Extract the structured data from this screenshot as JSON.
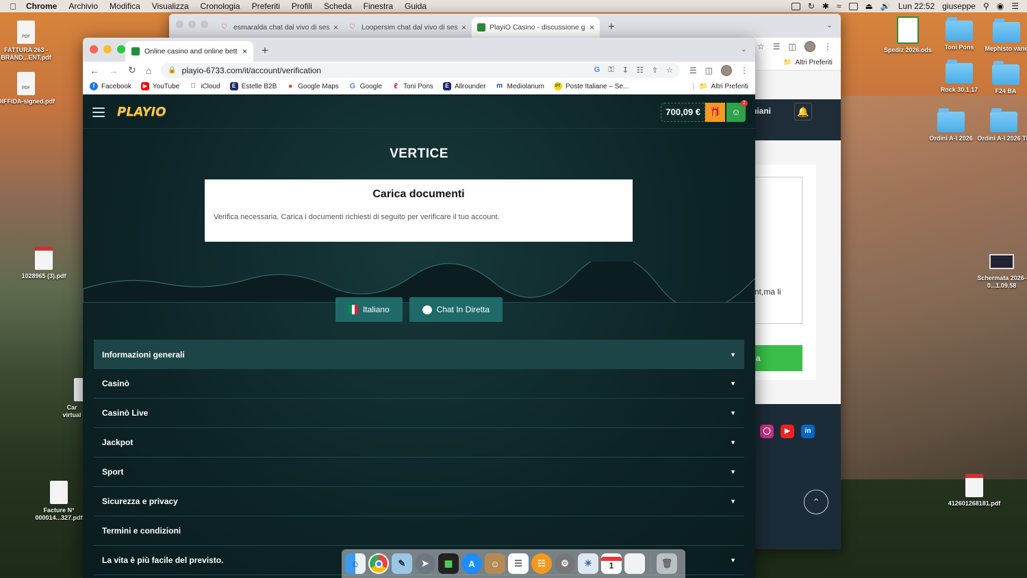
{
  "menubar": {
    "app": "Chrome",
    "items": [
      "Archivio",
      "Modifica",
      "Visualizza",
      "Cronologia",
      "Preferiti",
      "Profili",
      "Scheda",
      "Finestra",
      "Guida"
    ],
    "clock": "Lun 22:52",
    "user": "giuseppe"
  },
  "desktop_left": [
    {
      "label": "FATTURA 263 - BRAND...ENT.pdf"
    },
    {
      "label": "DIFFIDA-signed.pdf"
    },
    {
      "label": "1028965 (3).pdf"
    },
    {
      "label": "Car virtual"
    },
    {
      "label": "Facture N° 000014...327.pdf"
    }
  ],
  "desktop_right": [
    {
      "label": "Spediz 2026.ods"
    },
    {
      "label": "Toni Pons"
    },
    {
      "label": "Mephisto varie"
    },
    {
      "label": "Rock 30.1.17"
    },
    {
      "label": "F24 BA"
    },
    {
      "label": "Ordini A-I 2026"
    },
    {
      "label": "Ordini A-I 2026 TP"
    },
    {
      "label": "Schermata 2026-0...1.09.58"
    },
    {
      "label": "412601268181.pdf"
    }
  ],
  "bg_window": {
    "tabs": [
      {
        "title": "esmaralda chat dal vivo di ses"
      },
      {
        "title": "Loopersim chat dal vivo di ses"
      },
      {
        "title": "PlayiO Casino - discussione ge"
      }
    ],
    "bookmark_right": "Altri Preferiti",
    "nav_label": "niani",
    "card_text": "nt,ma li",
    "green_button": "a"
  },
  "browser": {
    "tab_title": "Online casino and online bettin",
    "url": "playio-6733.com/it/account/verification",
    "bookmarks": [
      "Facebook",
      "YouTube",
      "iCloud",
      "Estelle B2B",
      "Google Maps",
      "Google",
      "Toni Pons",
      "Allrounder",
      "Mediolanum",
      "Poste Italiane – Se..."
    ],
    "bookmarks_more": "Altri Preferiti"
  },
  "page": {
    "logo": "PLAYIO",
    "balance": "700,09 €",
    "notif_count": "2",
    "title": "VERTICE",
    "card_title": "Carica documenti",
    "card_text": "Verifica necessaria. Carica i documenti richiesti di seguito per verificare il tuo account.",
    "language_button": "Italiano",
    "chat_button": "Chat In Diretta",
    "accordion": [
      {
        "label": "Informazioni generali",
        "chevron": true
      },
      {
        "label": "Casinò",
        "chevron": true
      },
      {
        "label": "Casinò Live",
        "chevron": true
      },
      {
        "label": "Jackpot",
        "chevron": true
      },
      {
        "label": "Sport",
        "chevron": true
      },
      {
        "label": "Sicurezza e privacy",
        "chevron": true
      },
      {
        "label": "Termini e condizioni",
        "chevron": false
      },
      {
        "label": "La vita è più facile del previsto.",
        "chevron": true
      }
    ]
  },
  "dock": {
    "apps": [
      "finder-icon",
      "chrome-icon",
      "preview-icon",
      "launchpad-icon",
      "activity-monitor-icon",
      "app-store-icon",
      "contacts-icon",
      "reminders-icon",
      "books-icon",
      "system-preferences-icon",
      "photos-icon",
      "calendar-icon",
      "blank-doc-icon",
      "trash-icon"
    ],
    "calendar_day": "1"
  }
}
